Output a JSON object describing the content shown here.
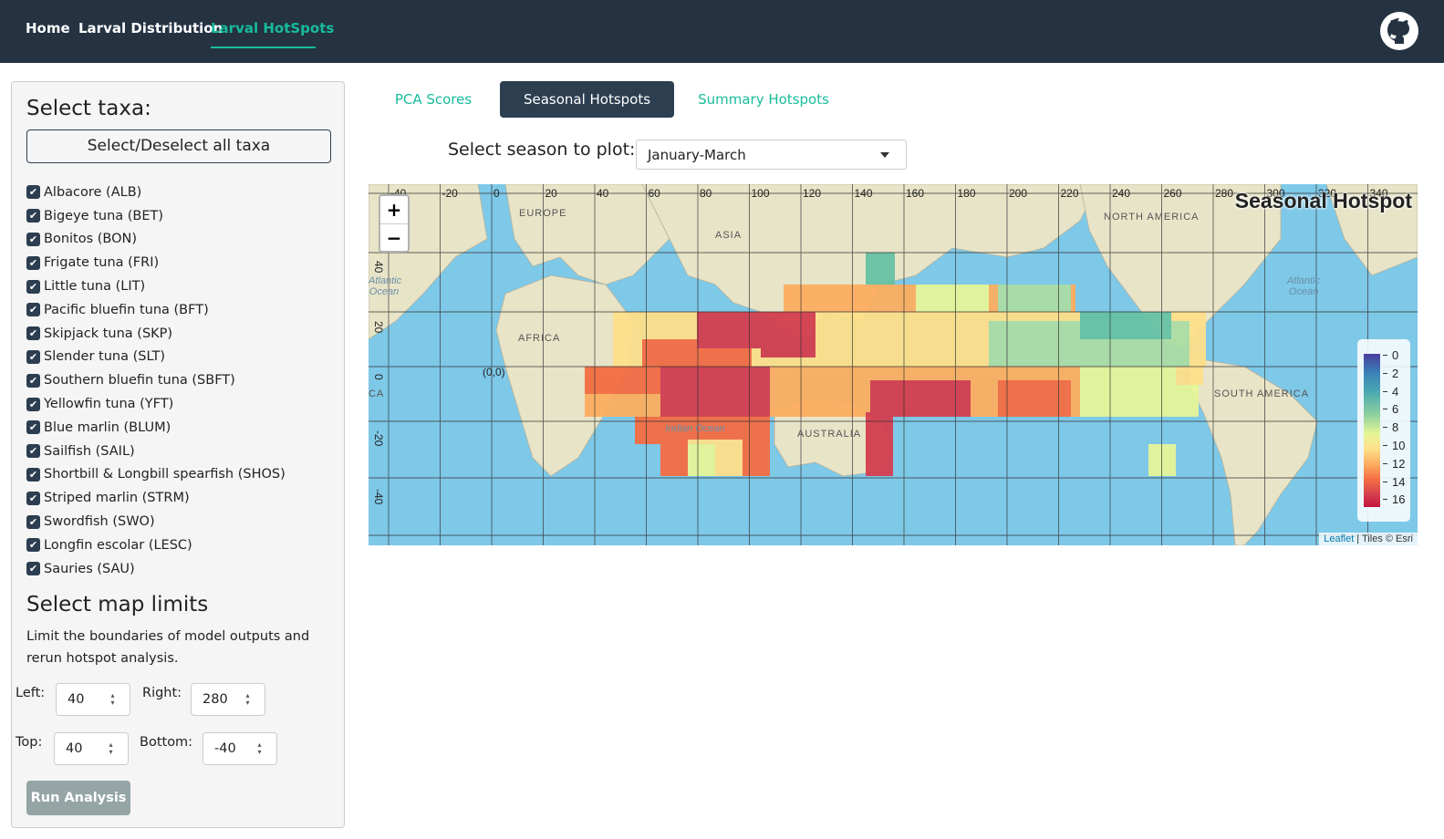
{
  "navbar": {
    "links": [
      "Home",
      "Larval Distribution",
      "Larval HotSpots"
    ],
    "active": "Larval HotSpots",
    "github_icon": "github-icon"
  },
  "sidebar": {
    "taxa_heading": "Select taxa:",
    "select_all_label": "Select/Deselect all taxa",
    "taxa": [
      {
        "label": "Albacore (ALB)",
        "checked": true
      },
      {
        "label": "Bigeye tuna (BET)",
        "checked": true
      },
      {
        "label": "Bonitos (BON)",
        "checked": true
      },
      {
        "label": "Frigate tuna (FRI)",
        "checked": true
      },
      {
        "label": "Little tuna (LIT)",
        "checked": true
      },
      {
        "label": "Pacific bluefin tuna (BFT)",
        "checked": true
      },
      {
        "label": "Skipjack tuna (SKP)",
        "checked": true
      },
      {
        "label": "Slender tuna (SLT)",
        "checked": true
      },
      {
        "label": "Southern bluefin tuna (SBFT)",
        "checked": true
      },
      {
        "label": "Yellowfin tuna (YFT)",
        "checked": true
      },
      {
        "label": "Blue marlin (BLUM)",
        "checked": true
      },
      {
        "label": "Sailfish (SAIL)",
        "checked": true
      },
      {
        "label": "Shortbill & Longbill spearfish (SHOS)",
        "checked": true
      },
      {
        "label": "Striped marlin (STRM)",
        "checked": true
      },
      {
        "label": "Swordfish (SWO)",
        "checked": true
      },
      {
        "label": "Longfin escolar (LESC)",
        "checked": true
      },
      {
        "label": "Sauries (SAU)",
        "checked": true
      }
    ],
    "limits_heading": "Select map limits",
    "limits_help": "Limit the boundaries of model outputs and rerun hotspot analysis.",
    "limits": {
      "left_label": "Left:",
      "left_value": "40",
      "right_label": "Right:",
      "right_value": "280",
      "top_label": "Top:",
      "top_value": "40",
      "bottom_label": "Bottom:",
      "bottom_value": "-40"
    },
    "run_label": "Run Analysis"
  },
  "main": {
    "tabs": [
      "PCA Scores",
      "Seasonal Hotspots",
      "Summary Hotspots"
    ],
    "active_tab": "Seasonal Hotspots",
    "season_label": "Select season to plot:",
    "season_value": "January-March"
  },
  "map": {
    "title": "Seasonal Hotspot",
    "zoom_in": "+",
    "zoom_out": "−",
    "lon_labels": [
      "-40",
      "-20",
      "0",
      "20",
      "40",
      "60",
      "80",
      "100",
      "120",
      "140",
      "160",
      "180",
      "200",
      "220",
      "240",
      "260",
      "280",
      "300",
      "320",
      "340",
      "360"
    ],
    "lat_labels": [
      "40",
      "20",
      "0",
      "-20",
      "-40"
    ],
    "origin_label": "(0,0)",
    "place_labels": [
      "EUROPE",
      "ASIA",
      "AFRICA",
      "AUSTRALIA",
      "NORTH AMERICA",
      "SOUTH AMERICA",
      "CA"
    ],
    "ocean_labels": [
      "Atlantic Ocean",
      "Indian Ocean",
      "Atlantic Ocean"
    ],
    "legend_ticks": [
      "0",
      "2",
      "4",
      "6",
      "8",
      "10",
      "12",
      "14",
      "16"
    ],
    "attribution_link": "Leaflet",
    "attribution_text": " | Tiles © Esri",
    "colors": {
      "navbar": "#243242",
      "accent": "#18bc9c",
      "active_tab": "#2c3e50",
      "ocean": "#7ec8e8"
    }
  }
}
